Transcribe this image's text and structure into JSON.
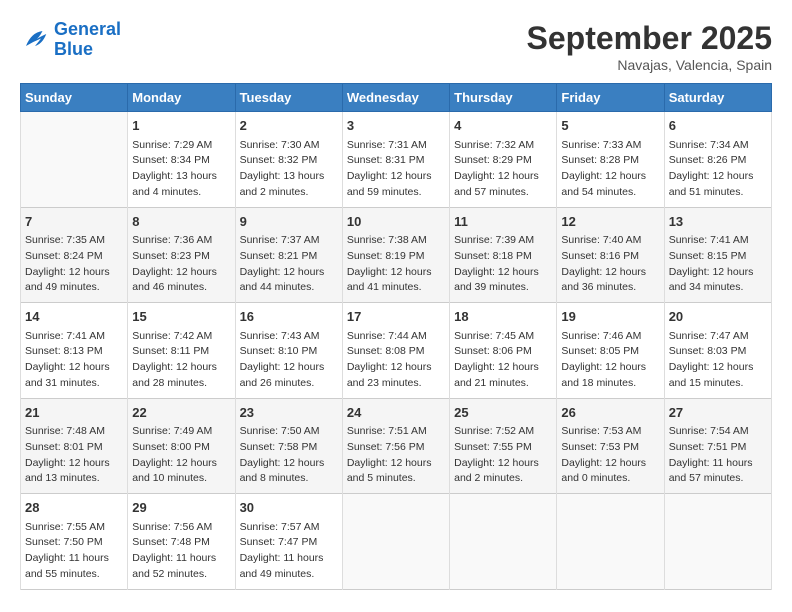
{
  "header": {
    "logo_line1": "General",
    "logo_line2": "Blue",
    "month": "September 2025",
    "location": "Navajas, Valencia, Spain"
  },
  "days_of_week": [
    "Sunday",
    "Monday",
    "Tuesday",
    "Wednesday",
    "Thursday",
    "Friday",
    "Saturday"
  ],
  "weeks": [
    [
      {
        "day": "",
        "info": ""
      },
      {
        "day": "1",
        "info": "Sunrise: 7:29 AM\nSunset: 8:34 PM\nDaylight: 13 hours\nand 4 minutes."
      },
      {
        "day": "2",
        "info": "Sunrise: 7:30 AM\nSunset: 8:32 PM\nDaylight: 13 hours\nand 2 minutes."
      },
      {
        "day": "3",
        "info": "Sunrise: 7:31 AM\nSunset: 8:31 PM\nDaylight: 12 hours\nand 59 minutes."
      },
      {
        "day": "4",
        "info": "Sunrise: 7:32 AM\nSunset: 8:29 PM\nDaylight: 12 hours\nand 57 minutes."
      },
      {
        "day": "5",
        "info": "Sunrise: 7:33 AM\nSunset: 8:28 PM\nDaylight: 12 hours\nand 54 minutes."
      },
      {
        "day": "6",
        "info": "Sunrise: 7:34 AM\nSunset: 8:26 PM\nDaylight: 12 hours\nand 51 minutes."
      }
    ],
    [
      {
        "day": "7",
        "info": "Sunrise: 7:35 AM\nSunset: 8:24 PM\nDaylight: 12 hours\nand 49 minutes."
      },
      {
        "day": "8",
        "info": "Sunrise: 7:36 AM\nSunset: 8:23 PM\nDaylight: 12 hours\nand 46 minutes."
      },
      {
        "day": "9",
        "info": "Sunrise: 7:37 AM\nSunset: 8:21 PM\nDaylight: 12 hours\nand 44 minutes."
      },
      {
        "day": "10",
        "info": "Sunrise: 7:38 AM\nSunset: 8:19 PM\nDaylight: 12 hours\nand 41 minutes."
      },
      {
        "day": "11",
        "info": "Sunrise: 7:39 AM\nSunset: 8:18 PM\nDaylight: 12 hours\nand 39 minutes."
      },
      {
        "day": "12",
        "info": "Sunrise: 7:40 AM\nSunset: 8:16 PM\nDaylight: 12 hours\nand 36 minutes."
      },
      {
        "day": "13",
        "info": "Sunrise: 7:41 AM\nSunset: 8:15 PM\nDaylight: 12 hours\nand 34 minutes."
      }
    ],
    [
      {
        "day": "14",
        "info": "Sunrise: 7:41 AM\nSunset: 8:13 PM\nDaylight: 12 hours\nand 31 minutes."
      },
      {
        "day": "15",
        "info": "Sunrise: 7:42 AM\nSunset: 8:11 PM\nDaylight: 12 hours\nand 28 minutes."
      },
      {
        "day": "16",
        "info": "Sunrise: 7:43 AM\nSunset: 8:10 PM\nDaylight: 12 hours\nand 26 minutes."
      },
      {
        "day": "17",
        "info": "Sunrise: 7:44 AM\nSunset: 8:08 PM\nDaylight: 12 hours\nand 23 minutes."
      },
      {
        "day": "18",
        "info": "Sunrise: 7:45 AM\nSunset: 8:06 PM\nDaylight: 12 hours\nand 21 minutes."
      },
      {
        "day": "19",
        "info": "Sunrise: 7:46 AM\nSunset: 8:05 PM\nDaylight: 12 hours\nand 18 minutes."
      },
      {
        "day": "20",
        "info": "Sunrise: 7:47 AM\nSunset: 8:03 PM\nDaylight: 12 hours\nand 15 minutes."
      }
    ],
    [
      {
        "day": "21",
        "info": "Sunrise: 7:48 AM\nSunset: 8:01 PM\nDaylight: 12 hours\nand 13 minutes."
      },
      {
        "day": "22",
        "info": "Sunrise: 7:49 AM\nSunset: 8:00 PM\nDaylight: 12 hours\nand 10 minutes."
      },
      {
        "day": "23",
        "info": "Sunrise: 7:50 AM\nSunset: 7:58 PM\nDaylight: 12 hours\nand 8 minutes."
      },
      {
        "day": "24",
        "info": "Sunrise: 7:51 AM\nSunset: 7:56 PM\nDaylight: 12 hours\nand 5 minutes."
      },
      {
        "day": "25",
        "info": "Sunrise: 7:52 AM\nSunset: 7:55 PM\nDaylight: 12 hours\nand 2 minutes."
      },
      {
        "day": "26",
        "info": "Sunrise: 7:53 AM\nSunset: 7:53 PM\nDaylight: 12 hours\nand 0 minutes."
      },
      {
        "day": "27",
        "info": "Sunrise: 7:54 AM\nSunset: 7:51 PM\nDaylight: 11 hours\nand 57 minutes."
      }
    ],
    [
      {
        "day": "28",
        "info": "Sunrise: 7:55 AM\nSunset: 7:50 PM\nDaylight: 11 hours\nand 55 minutes."
      },
      {
        "day": "29",
        "info": "Sunrise: 7:56 AM\nSunset: 7:48 PM\nDaylight: 11 hours\nand 52 minutes."
      },
      {
        "day": "30",
        "info": "Sunrise: 7:57 AM\nSunset: 7:47 PM\nDaylight: 11 hours\nand 49 minutes."
      },
      {
        "day": "",
        "info": ""
      },
      {
        "day": "",
        "info": ""
      },
      {
        "day": "",
        "info": ""
      },
      {
        "day": "",
        "info": ""
      }
    ]
  ]
}
